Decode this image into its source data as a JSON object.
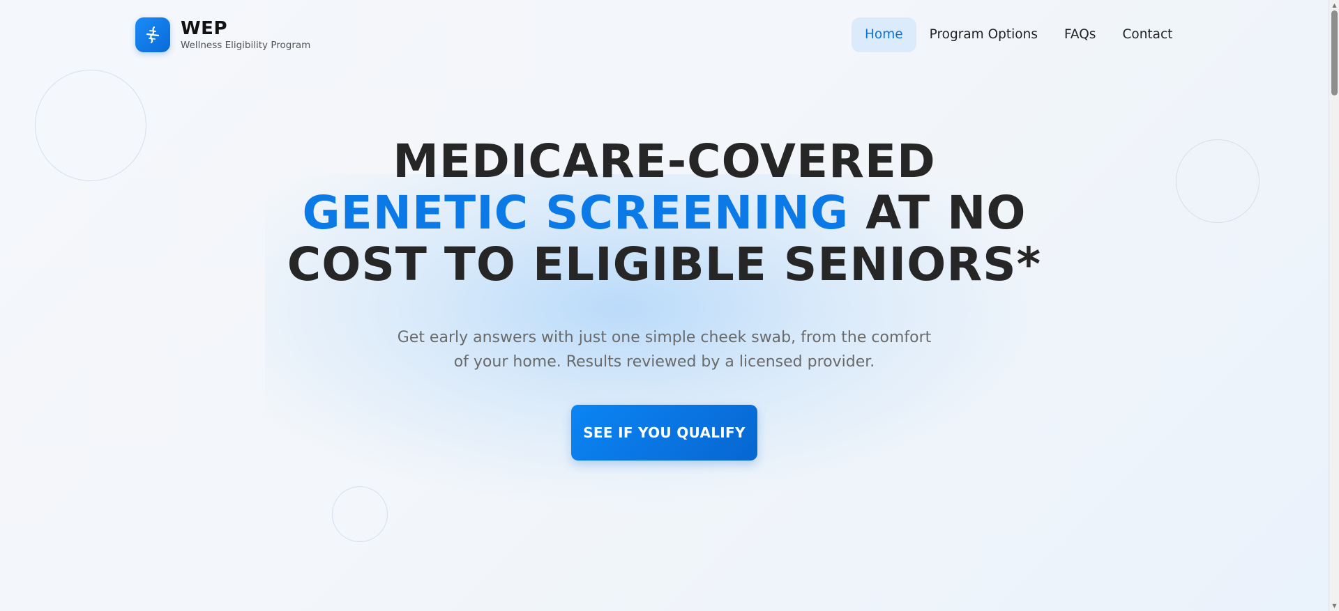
{
  "brand": {
    "title": "WEP",
    "subtitle": "Wellness Eligibility Program",
    "logo_icon": "dna-icon"
  },
  "nav": {
    "items": [
      {
        "label": "Home",
        "active": true
      },
      {
        "label": "Program Options",
        "active": false
      },
      {
        "label": "FAQs",
        "active": false
      },
      {
        "label": "Contact",
        "active": false
      }
    ]
  },
  "hero": {
    "line1": "MEDICARE-COVERED",
    "line2_highlight": "GENETIC SCREENING",
    "line2_rest": " AT NO",
    "line3": "COST TO ELIGIBLE SENIORS*",
    "subtitle_line1": "Get early answers with just one simple cheek swab, from the comfort",
    "subtitle_line2": "of your home. Results reviewed by a licensed provider.",
    "cta_label": "SEE IF YOU QUALIFY"
  },
  "colors": {
    "accent": "#0b7ae6",
    "nav_active_bg": "#dcebfb",
    "heading": "#262626"
  }
}
